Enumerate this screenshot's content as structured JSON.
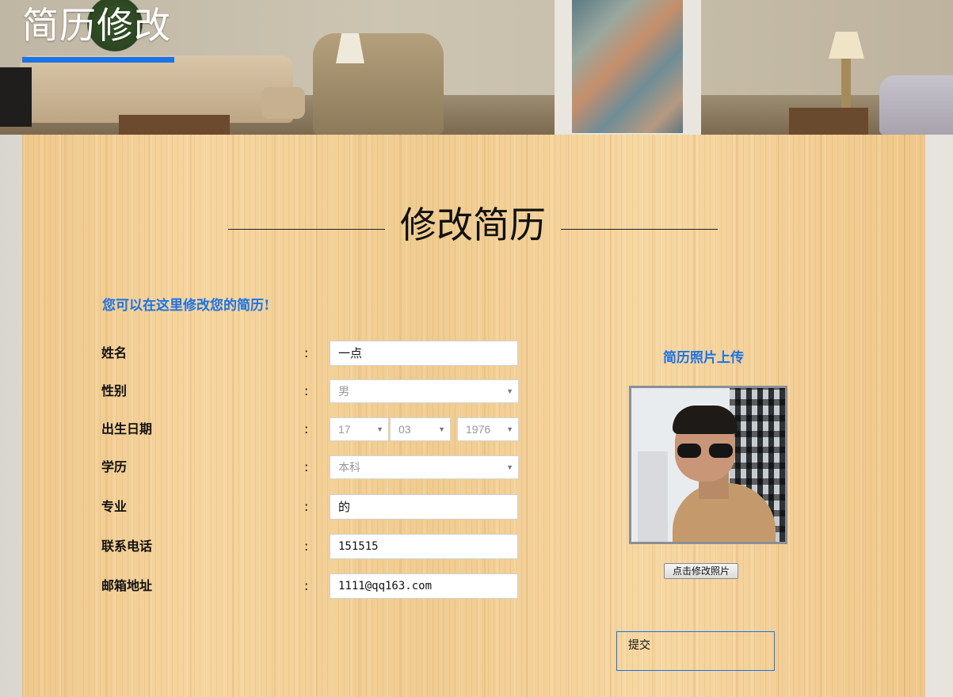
{
  "header": {
    "title": "简历修改"
  },
  "main": {
    "heading": "修改简历",
    "intro": "您可以在这里修改您的简历!",
    "colon": ":",
    "fields": {
      "name": {
        "label": "姓名",
        "value": "一点"
      },
      "gender": {
        "label": "性别",
        "value": "男"
      },
      "birth": {
        "label": "出生日期",
        "day": "17",
        "month": "03",
        "year": "1976"
      },
      "education": {
        "label": "学历",
        "value": "本科"
      },
      "major": {
        "label": "专业",
        "value": "的"
      },
      "phone": {
        "label": "联系电话",
        "value": "151515"
      },
      "email": {
        "label": "邮箱地址",
        "value": "1111@qq163.com"
      }
    },
    "photo": {
      "title": "简历照片上传",
      "button_label": "点击修改照片"
    },
    "submit_label": "提交"
  },
  "colors": {
    "accent": "#1a73e8",
    "panel": "#f3d09a"
  },
  "icons": {
    "dropdown": "chevron-down-icon"
  }
}
